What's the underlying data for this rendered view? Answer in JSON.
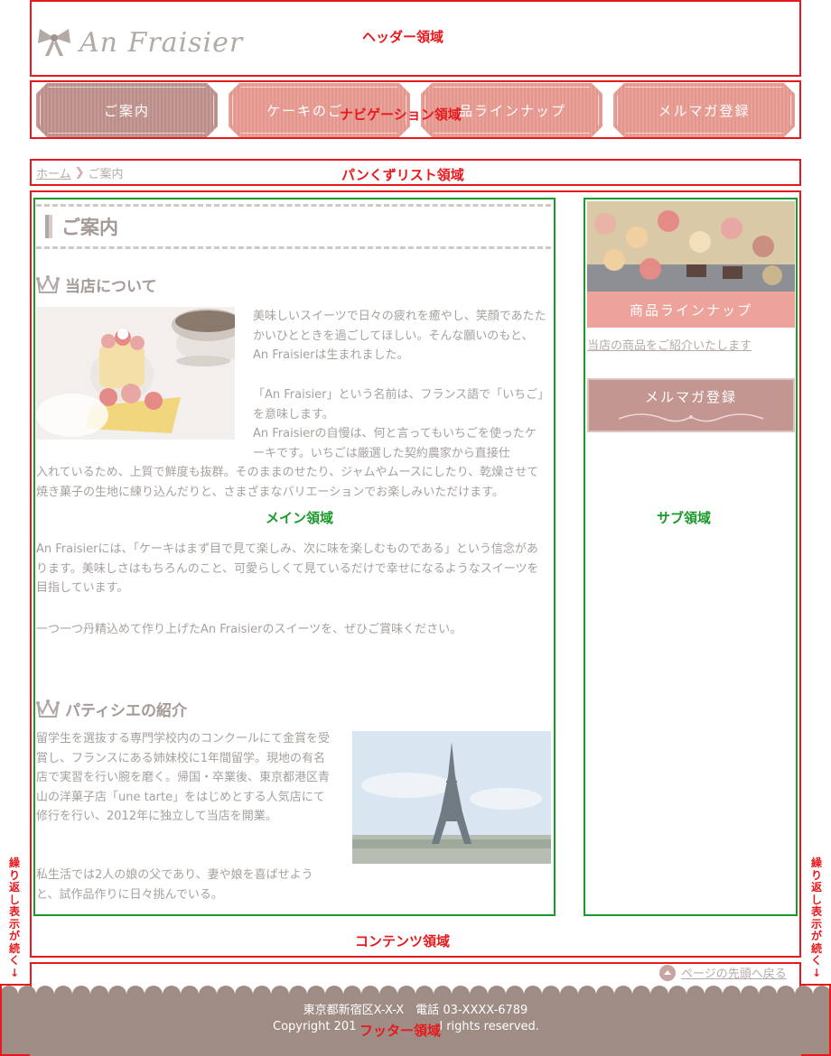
{
  "header": {
    "logo_text": "An Fraisier",
    "region_label": "ヘッダー領域"
  },
  "nav": {
    "region_label": "ナビゲーション領域",
    "items": [
      {
        "label": "ご案内"
      },
      {
        "label": "ケーキのご"
      },
      {
        "label": "品ラインナップ"
      },
      {
        "label": "メルマガ登録"
      }
    ]
  },
  "breadcrumb": {
    "home": "ホーム",
    "current": "ご案内",
    "region_label": "パンくずリスト領域"
  },
  "main": {
    "heading": "ご案内",
    "region_label": "メイン領域",
    "about": {
      "title": "当店について",
      "p1": "美味しいスイーツで日々の疲れを癒やし、笑顔であたたかいひとときを過ごしてほしい。そんな願いのもと、An Fraisierは生まれました。",
      "p2": "「An Fraisier」という名前は、フランス語で「いちご」を意味します。",
      "p3a": "An Fraisierの自慢は、何と言ってもいちごを使ったケーキです。いちごは厳選した契約農家から直接仕",
      "p3b": "入れているため、上質で鮮度も抜群。そのままのせたり、ジャムやムースにしたり、乾燥させて焼き菓子の生地に練り込んだりと、さまざまなバリエーションでお楽しみいただけます。",
      "p4": "An Fraisierには、「ケーキはまず目で見て楽しみ、次に味を楽しむものである」という信念があります。美味しさはもちろんのこと、可愛らしくて見ているだけで幸せになるようなスイーツを目指しています。",
      "p5": "一つ一つ丹精込めて作り上げたAn Fraisierのスイーツを、ぜひご賞味ください。"
    },
    "patissier": {
      "title": "パティシエの紹介",
      "p1": "留学生を選抜する専門学校内のコンクールにて金賞を受賞し、フランスにある姉妹校に1年間留学。現地の有名店で実習を行い腕を磨く。帰国・卒業後、東京都港区青山の洋菓子店「une tarte」をはじめとする人気店にて修行を行い、2012年に独立して当店を開業。",
      "p2": "私生活では2人の娘の父であり、妻や娘を喜ばせようと、試作品作りに日々挑んでいる。"
    }
  },
  "sub": {
    "region_label": "サブ領域",
    "lineup_banner": "商品ラインナップ",
    "lineup_link": "当店の商品をご紹介いたします",
    "mail_banner": "メルマガ登録"
  },
  "contents_label": "コンテンツ領域",
  "footer": {
    "page_top": "ページの先頭へ戻る",
    "address": "東京都新宿区X-X-X　電話 03-XXXX-6789",
    "copyright_left": "Copyright 201",
    "copyright_right": "l rights reserved.",
    "region_label": "フッター領域"
  },
  "repeat_note": "繰り返し表示が続く↓",
  "colors": {
    "region_red": "#e8191c",
    "region_green": "#1a9a2a",
    "nav_pink": "#e9a29a",
    "nav_active": "#c49a96",
    "footer_brown": "#9e8c85"
  }
}
